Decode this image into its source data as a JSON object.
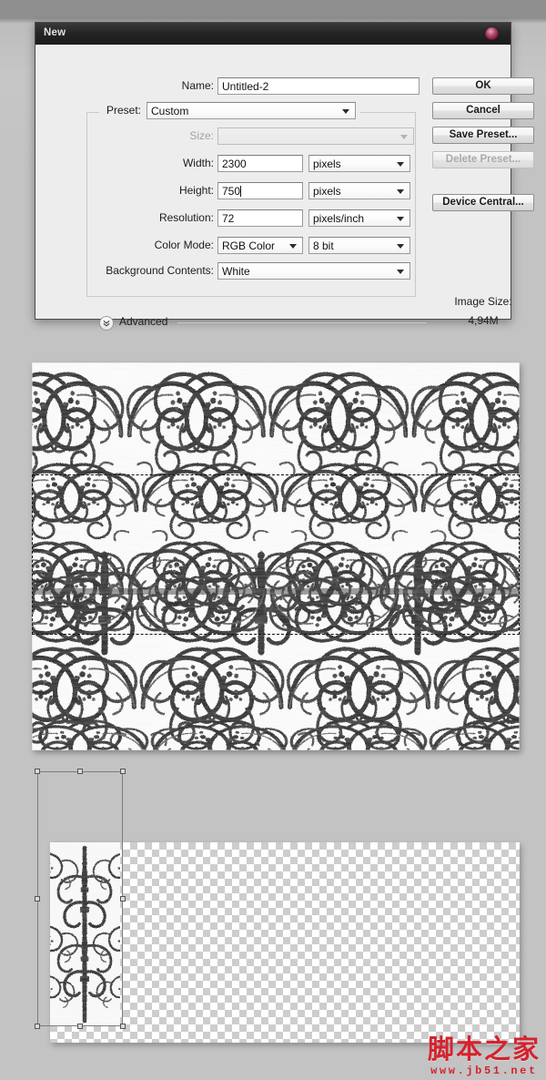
{
  "dialog": {
    "title": "New",
    "close_icon": "close-orb-icon",
    "fields": {
      "name": {
        "label": "Name:",
        "value": "Untitled-2"
      },
      "preset": {
        "label": "Preset:",
        "value": "Custom"
      },
      "size": {
        "label": "Size:",
        "value": "",
        "disabled": true
      },
      "width": {
        "label": "Width:",
        "value": "2300",
        "unit": "pixels"
      },
      "height": {
        "label": "Height:",
        "value": "750",
        "unit": "pixels",
        "has_caret": true
      },
      "resolution": {
        "label": "Resolution:",
        "value": "72",
        "unit": "pixels/inch"
      },
      "color_mode": {
        "label": "Color Mode:",
        "value": "RGB Color",
        "depth": "8 bit"
      },
      "background_contents": {
        "label": "Background Contents:",
        "value": "White"
      }
    },
    "advanced": {
      "label": "Advanced",
      "icon": "chevron-double-down-icon",
      "expanded": false
    },
    "image_size": {
      "label": "Image Size:",
      "value": "4,94M"
    },
    "buttons": [
      {
        "label": "OK",
        "disabled": false
      },
      {
        "label": "Cancel",
        "disabled": false
      },
      {
        "label": "Save Preset...",
        "disabled": false
      },
      {
        "label": "Delete Preset...",
        "disabled": true
      },
      {
        "label": "Device Central...",
        "disabled": false
      }
    ]
  },
  "canvas": {
    "photo": {
      "alt": "baroque ornamental scrollwork relief, black and white",
      "selection": {
        "style": "marching-ants-dashed"
      }
    },
    "layer_panel": {
      "alt": "vertical ornamental motif on transparent background",
      "transform": {
        "handles": 8,
        "style": "free-transform-bounding-box"
      }
    }
  },
  "watermark": {
    "cn": "脚本之家",
    "url": "www.jb51.net",
    "color": "#d4232e"
  },
  "theme": {
    "dialog_bg": "#ededed",
    "titlebar": "#1f1f1f",
    "canvas_bg": "#c3c3c3",
    "close_orb": "#7d1f3c"
  }
}
